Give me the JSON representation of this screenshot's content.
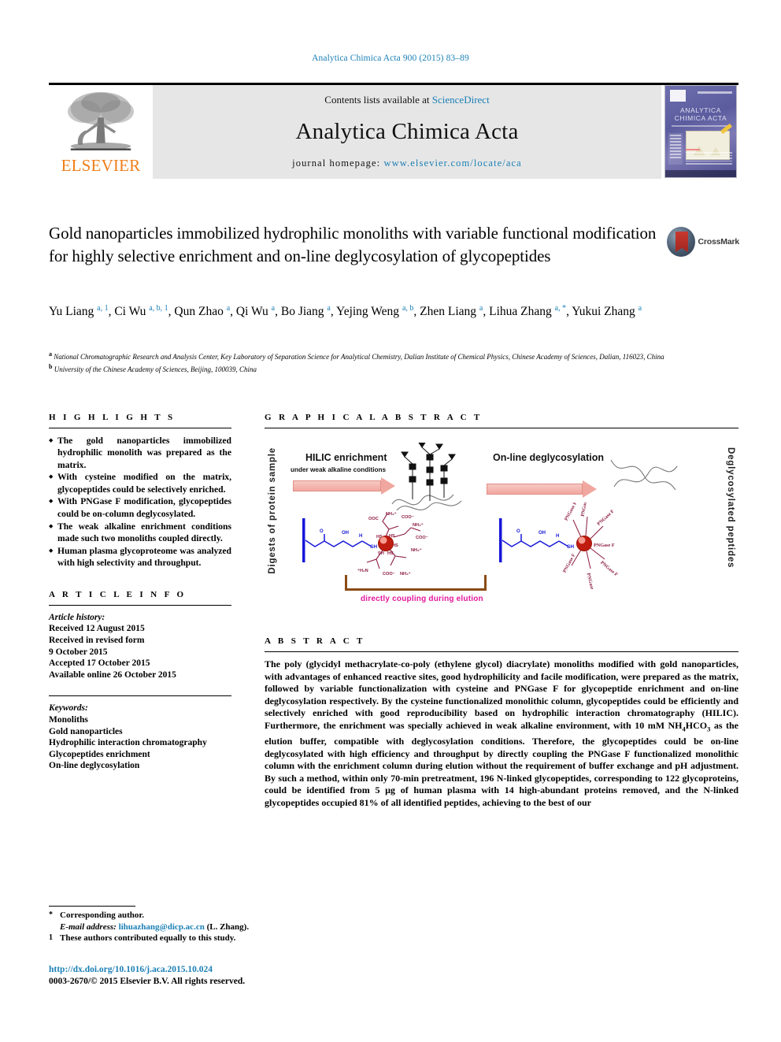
{
  "running_head": "Analytica Chimica Acta 900 (2015) 83–89",
  "masthead": {
    "contents_prefix": "Contents lists available at",
    "contents_link": "ScienceDirect",
    "journal_title": "Analytica Chimica Acta",
    "homepage_prefix": "journal homepage:",
    "homepage_url": "www.elsevier.com/locate/aca",
    "publisher": "ELSEVIER",
    "cover_title_line1": "ANALYTICA",
    "cover_title_line2": "CHIMICA ACTA"
  },
  "crossmark": {
    "label": "CrossMark"
  },
  "title": "Gold nanoparticles immobilized hydrophilic monoliths with variable functional modification for highly selective enrichment and on-line deglycosylation of glycopeptides",
  "authors_html": "Yu Liang <sup>a, 1</sup>, Ci Wu <sup>a, b, 1</sup>, Qun Zhao <sup>a</sup>, Qi Wu <sup>a</sup>, Bo Jiang <sup>a</sup>, Yejing Weng <sup>a, b</sup>, Zhen Liang <sup>a</sup>, Lihua Zhang <sup>a, *</sup>, Yukui Zhang <sup>a</sup>",
  "affiliations": [
    {
      "mark": "a",
      "text": "National Chromatographic Research and Analysis Center, Key Laboratory of Separation Science for Analytical Chemistry, Dalian Institute of Chemical Physics, Chinese Academy of Sciences, Dalian, 116023, China"
    },
    {
      "mark": "b",
      "text": "University of the Chinese Academy of Sciences, Beijing, 100039, China"
    }
  ],
  "sections": {
    "highlights_head": "H I G H L I G H T S",
    "graphical_abstract_head": "G R A P H I C A L   A B S T R A C T",
    "article_info_head": "A R T I C L E   I N F O",
    "abstract_head": "A B S T R A C T"
  },
  "highlights": [
    "The gold nanoparticles immobilized hydrophilic monolith was prepared as the matrix.",
    "With cysteine modified on the matrix, glycopeptides could be selectively enriched.",
    "With PNGase F modification, glycopeptides could be on-column deglycosylated.",
    "The weak alkaline enrichment conditions made such two monoliths coupled directly.",
    "Human plasma glycoproteome was analyzed with high selectivity and throughput."
  ],
  "article_history": {
    "label": "Article history:",
    "lines": [
      "Received 12 August 2015",
      "Received in revised form",
      "9 October 2015",
      "Accepted 17 October 2015",
      "Available online 26 October 2015"
    ]
  },
  "keywords": {
    "label": "Keywords:",
    "items": [
      "Monoliths",
      "Gold nanoparticles",
      "Hydrophilic interaction chromatography",
      "Glycopeptides enrichment",
      "On-line deglycosylation"
    ]
  },
  "abstract_html": "The poly (glycidyl methacrylate-co-poly (ethylene glycol) diacrylate) monoliths modified with gold nanoparticles, with advantages of enhanced reactive sites, good hydrophilicity and facile modification, were prepared as the matrix, followed by variable functionalization with cysteine and PNGase F for glycopeptide enrichment and on-line deglycosylation respectively. By the cysteine functionalized monolithic column, glycopeptides could be efficiently and selectively enriched with good reproducibility based on hydrophilic interaction chromatography (HILIC). Furthermore, the enrichment was specially achieved in weak alkaline environment, with 10 mM NH<sub>4</sub>HCO<sub>3</sub> as the elution buffer, compatible with deglycosylation conditions. Therefore, the glycopeptides could be on-line deglycosylated with high efficiency and throughput by directly coupling the PNGase F functionalized monolithic column with the enrichment column during elution without the requirement of buffer exchange and pH adjustment. By such a method, within only 70-min pretreatment, 196 N-linked glycopeptides, corresponding to 122 glycoproteins, could be identified from 5 µg of human plasma with 14 high-abundant proteins removed, and the N-linked glycopeptides occupied 81% of all identified peptides, achieving to the best of our",
  "graphical_abstract": {
    "left_label": "Digests of protein sample",
    "right_label": "Deglycosylated peptides",
    "step1_title": "HILIC enrichment",
    "step1_sub": "under weak alkaline conditions",
    "step2_title": "On-line deglycosylation",
    "coupling_label": "directly coupling during elution",
    "enzyme_label": "PNGase F",
    "thiol_label": "SH",
    "hydroxyl_label": "OH",
    "nitrogen_label": "H",
    "chem_labels": [
      "OOC",
      "NH₃⁺",
      "COO⁻",
      "HS",
      "NH₃⁺",
      "COO⁻",
      "⁺H₃N",
      "COO⁻",
      "NH₃⁺"
    ],
    "colors": {
      "arrow": "#f0a79f",
      "nanoparticle": "#f05a4a",
      "backbone": "#1717d8",
      "cysteine": "#8b1b3f",
      "bracket": "#8a4b16",
      "coupling_text": "#e2189c"
    }
  },
  "footnotes": [
    {
      "mark": "*",
      "text_before": "Corresponding author.",
      "email_label": "E-mail address:",
      "email": "lihuazhang@dicp.ac.cn",
      "email_suffix": "(L. Zhang)."
    },
    {
      "mark": "1",
      "text_before": "These authors contributed equally to this study."
    }
  ],
  "doi": "http://dx.doi.org/10.1016/j.aca.2015.10.024",
  "copyright": "0003-2670/© 2015 Elsevier B.V. All rights reserved.",
  "colors": {
    "link": "#1a7fb5",
    "elsevier_orange": "#ef7d1a",
    "masthead_bg": "#e6e6e6"
  }
}
